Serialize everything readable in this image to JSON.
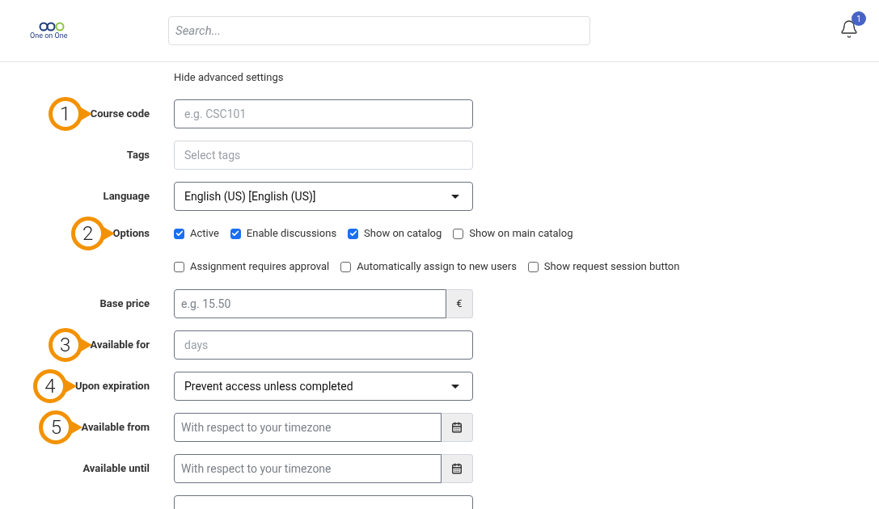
{
  "header": {
    "logo_text": "One on One",
    "search": {
      "placeholder": "Search..."
    },
    "notifications": {
      "count": "1"
    }
  },
  "advanced_link": "Hide advanced settings",
  "rows": [
    {
      "kind": "text",
      "label": "Course code",
      "placeholder": "e.g. CSC101",
      "callout": "1",
      "focused": true
    },
    {
      "kind": "text",
      "label": "Tags",
      "placeholder": "Select tags",
      "focused": false
    },
    {
      "kind": "select",
      "label": "Language",
      "value": "English (US) [English (US)]"
    },
    {
      "kind": "checkboxes",
      "label": "Options",
      "callout": "2",
      "options": [
        {
          "label": "Active",
          "checked": true
        },
        {
          "label": "Enable discussions",
          "checked": true
        },
        {
          "label": "Show on catalog",
          "checked": true
        },
        {
          "label": "Show on main catalog",
          "checked": false
        }
      ]
    },
    {
      "kind": "checkboxes",
      "options": [
        {
          "label": "Assignment requires approval",
          "checked": false
        },
        {
          "label": "Automatically assign to new users",
          "checked": false
        },
        {
          "label": "Show request session button",
          "checked": false
        }
      ]
    },
    {
      "kind": "addon",
      "label": "Base price",
      "placeholder": "e.g. 15.50",
      "addon": "€"
    },
    {
      "kind": "text",
      "label": "Available for",
      "placeholder": "days",
      "callout": "3",
      "focused": true
    },
    {
      "kind": "select",
      "label": "Upon expiration",
      "value": "Prevent access unless completed",
      "callout": "4"
    },
    {
      "kind": "date",
      "label": "Available from",
      "placeholder": "With respect to your timezone",
      "callout": "5"
    },
    {
      "kind": "date",
      "label": "Available until",
      "placeholder": "With respect to your timezone"
    },
    {
      "kind": "text",
      "focused": true
    }
  ]
}
